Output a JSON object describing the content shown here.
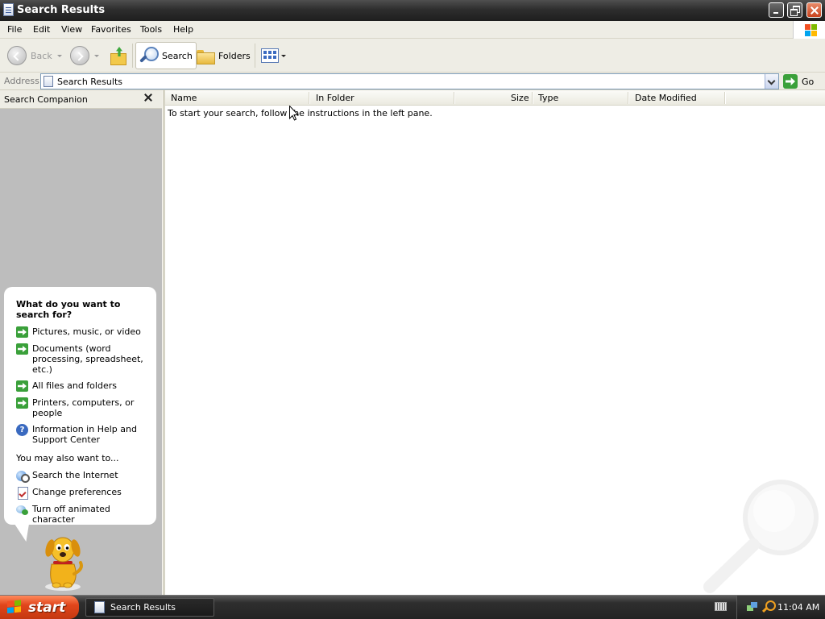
{
  "window": {
    "title": "Search Results",
    "icon": "document-icon"
  },
  "menu": [
    "File",
    "Edit",
    "View",
    "Favorites",
    "Tools",
    "Help"
  ],
  "toolbar": {
    "back_label": "Back",
    "search_label": "Search",
    "folders_label": "Folders"
  },
  "address": {
    "label": "Address",
    "value": "Search Results",
    "go_label": "Go"
  },
  "companion": {
    "title": "Search Companion",
    "question": "What do you want to search for?",
    "options": [
      "Pictures, music, or video",
      "Documents (word processing, spreadsheet, etc.)",
      "All files and folders",
      "Printers, computers, or people",
      "Information in Help and Support Center"
    ],
    "also_label": "You may also want to...",
    "also_links": [
      "Search the Internet",
      "Change preferences",
      "Turn off animated character"
    ]
  },
  "results": {
    "columns": [
      "Name",
      "In Folder",
      "Size",
      "Type",
      "Date Modified"
    ],
    "message": "To start your search, follow the instructions in the left pane."
  },
  "taskbar": {
    "start_label": "start",
    "task_label": "Search Results",
    "clock": "11:04 AM"
  },
  "colors": {
    "title_bar": "#2e2e2e",
    "start_button": "#e1461c",
    "companion_bg": "#bdbdbd",
    "action_arrow": "#3aa03a"
  }
}
